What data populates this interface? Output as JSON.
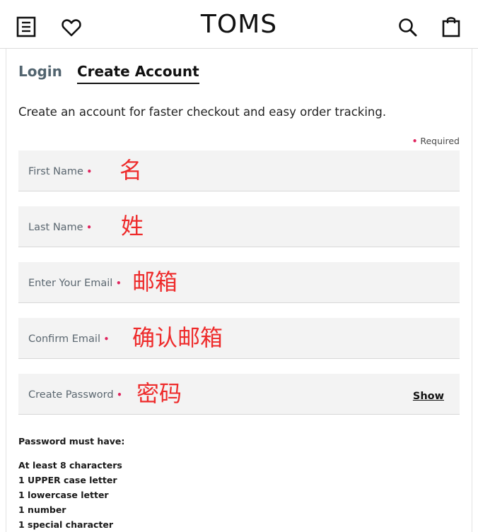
{
  "header": {
    "brand": "TOMS",
    "icons": [
      "menu-icon",
      "heart-icon",
      "search-icon",
      "shopping-bag-icon"
    ]
  },
  "tabs": [
    {
      "label": "Login",
      "active": false
    },
    {
      "label": "Create Account",
      "active": true
    }
  ],
  "intro": "Create an account for faster checkout and easy order tracking.",
  "required_marker": "•",
  "required_label": "Required",
  "fields": {
    "first_name": {
      "label": "First Name",
      "annotation": "名"
    },
    "last_name": {
      "label": "Last Name",
      "annotation": "姓"
    },
    "email": {
      "label": "Enter Your Email",
      "annotation": "邮箱"
    },
    "confirm_email": {
      "label": "Confirm Email",
      "annotation": "确认邮箱"
    },
    "password": {
      "label": "Create Password",
      "annotation": "密码",
      "show_label": "Show"
    }
  },
  "password_rules": {
    "heading": "Password must have:",
    "items": [
      "At least 8 characters",
      "1 UPPER case letter",
      "1 lowercase letter",
      "1 number",
      "1 special character"
    ]
  },
  "colors": {
    "required_dot": "#e0245e",
    "annotation": "#ee2b2b",
    "field_bg": "#f3f3f3",
    "inactive_tab": "#52646f"
  }
}
